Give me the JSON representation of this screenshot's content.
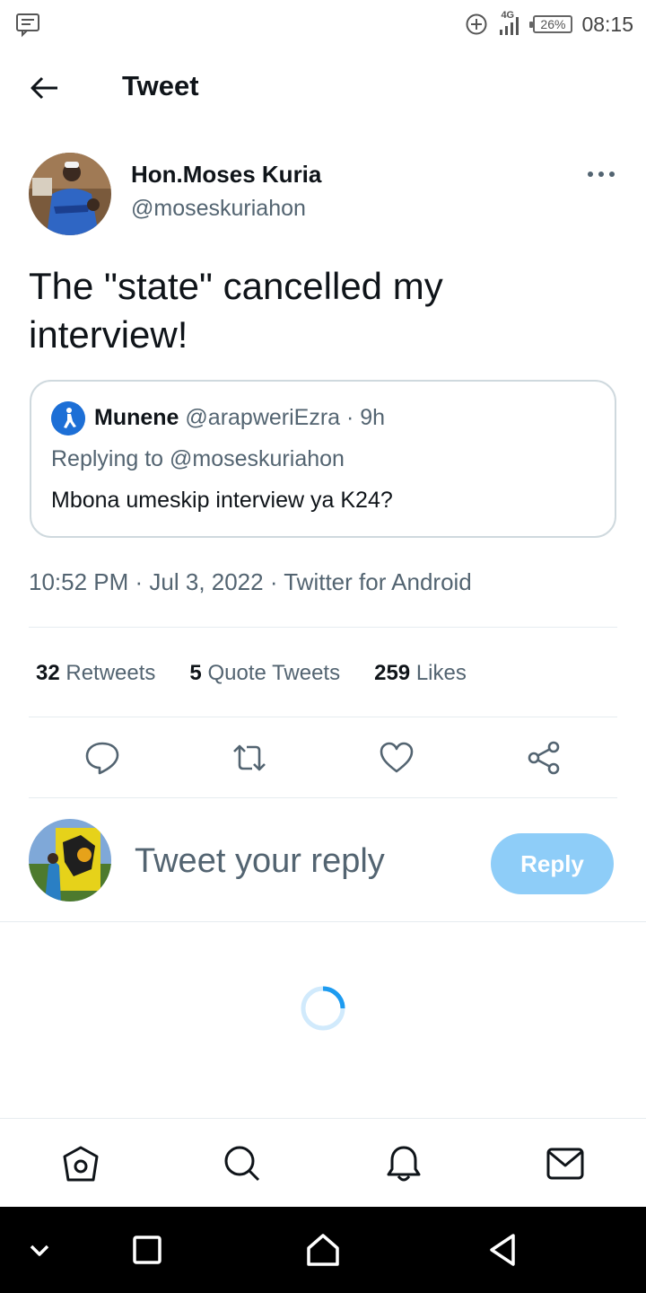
{
  "status_bar": {
    "network": "4G",
    "battery": "26%",
    "time": "08:15"
  },
  "header": {
    "title": "Tweet"
  },
  "tweet": {
    "author_name": "Hon.Moses Kuria",
    "author_handle": "@moseskuriahon",
    "text": "The \"state\" cancelled my interview!",
    "timestamp": "10:52 PM · Jul 3, 2022 · Twitter for Android"
  },
  "quoted": {
    "name": "Munene",
    "meta": "@arapweriEzra · 9h",
    "replying_to": "Replying to @moseskuriahon",
    "text": "Mbona umeskip interview ya K24?"
  },
  "stats": {
    "retweets_count": "32",
    "retweets_label": "Retweets",
    "quotes_count": "5",
    "quotes_label": "Quote Tweets",
    "likes_count": "259",
    "likes_label": "Likes"
  },
  "composer": {
    "placeholder": "Tweet your reply",
    "reply_label": "Reply"
  },
  "colors": {
    "accent": "#1d9bf0",
    "reply_button_disabled": "#8ecdf8",
    "secondary_text": "#536471",
    "border": "#cfd9de"
  },
  "icons": {
    "actions": [
      "reply-icon",
      "retweet-icon",
      "like-icon",
      "share-icon"
    ],
    "tabs": [
      "home-icon",
      "search-icon",
      "notifications-icon",
      "messages-icon"
    ],
    "system_nav": [
      "chevron-down-icon",
      "recents-icon",
      "home-nav-icon",
      "back-nav-icon"
    ]
  }
}
